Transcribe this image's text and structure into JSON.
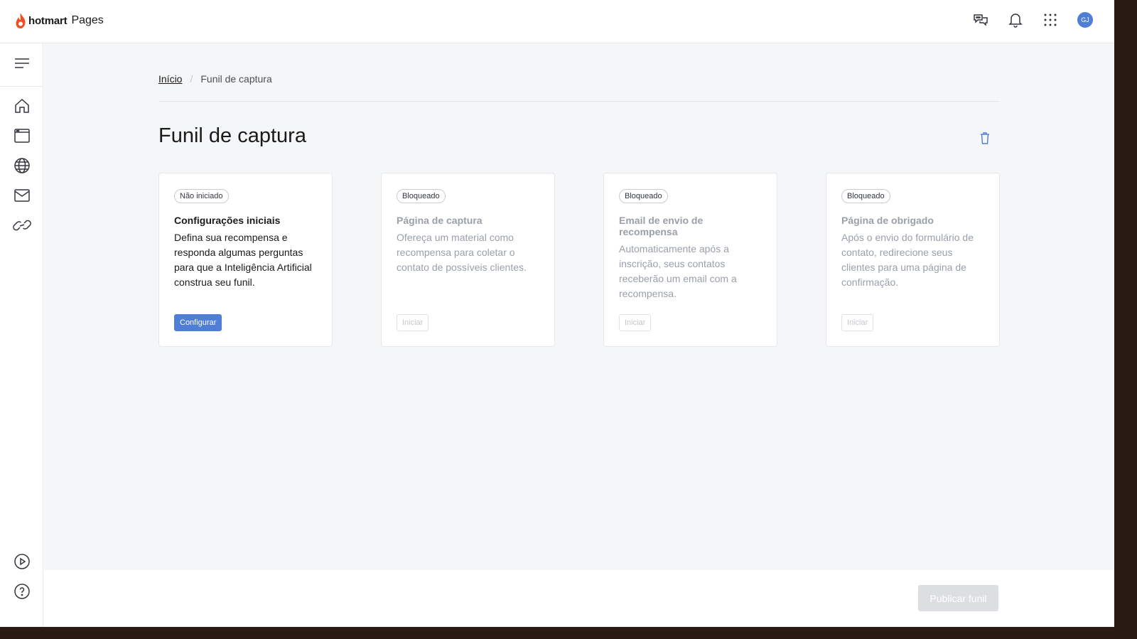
{
  "header": {
    "brand": "hotmart",
    "product": "Pages",
    "avatar_initials": "GJ",
    "icons": [
      "chat-icon",
      "bell-icon",
      "apps-grid-icon"
    ]
  },
  "sidebar": {
    "items": [
      "menu-icon",
      "home-icon",
      "browser-icon",
      "globe-icon",
      "mail-icon",
      "link-icon",
      "play-icon",
      "help-icon"
    ]
  },
  "breadcrumb": {
    "home": "Início",
    "separator": "/",
    "current": "Funil de captura"
  },
  "page": {
    "title": "Funil de captura"
  },
  "cards": [
    {
      "badge": "Não iniciado",
      "title": "Configurações iniciais",
      "description": "Defina sua recompensa e responda algumas perguntas para que a Inteligência Artificial construa seu funil.",
      "button": "Configurar"
    },
    {
      "badge": "Bloqueado",
      "title": "Página de captura",
      "description": "Ofereça um material como recompensa para coletar o contato de possíveis clientes.",
      "button": "Iniciar"
    },
    {
      "badge": "Bloqueado",
      "title": "Email de envio de recompensa",
      "description": "Automaticamente após a inscrição, seus contatos receberão um email com a recompensa.",
      "button": "Iniciar"
    },
    {
      "badge": "Bloqueado",
      "title": "Página de obrigado",
      "description": "Após o envio do formulário de contato, redirecione seus clientes para uma página de confirmação.",
      "button": "Iniciar"
    }
  ],
  "footer": {
    "publish_label": "Publicar funil"
  },
  "colors": {
    "accent": "#4f7ed6",
    "brand_flame": "#f04e23",
    "background": "#f5f6f8"
  }
}
